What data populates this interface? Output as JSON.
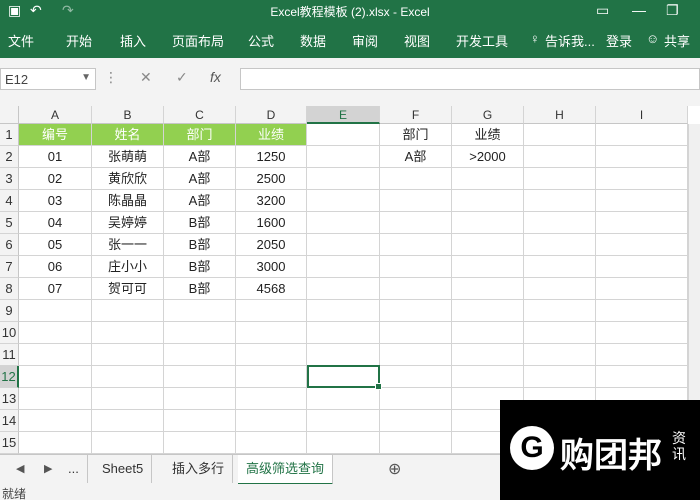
{
  "window": {
    "title": "Excel教程模板 (2).xlsx - Excel",
    "undo_icon": "undo-icon",
    "redo_icon": "redo-icon"
  },
  "ribbon": {
    "tabs": [
      "文件",
      "开始",
      "插入",
      "页面布局",
      "公式",
      "数据",
      "审阅",
      "视图",
      "开发工具"
    ],
    "tell_me": "告诉我...",
    "login": "登录",
    "share": "共享"
  },
  "formula_bar": {
    "name_box": "E12",
    "cancel_icon": "✕",
    "enter_icon": "✓",
    "fx": "fx",
    "value": ""
  },
  "sheet": {
    "columns": [
      "A",
      "B",
      "C",
      "D",
      "E",
      "F",
      "G",
      "H",
      "I"
    ],
    "rows": [
      "1",
      "2",
      "3",
      "4",
      "5",
      "6",
      "7",
      "8",
      "9",
      "10",
      "11",
      "12",
      "13",
      "14",
      "15"
    ],
    "table_headers": [
      "编号",
      "姓名",
      "部门",
      "业绩"
    ],
    "table_rows": [
      [
        "01",
        "张萌萌",
        "A部",
        "1250"
      ],
      [
        "02",
        "黄欣欣",
        "A部",
        "2500"
      ],
      [
        "03",
        "陈晶晶",
        "A部",
        "3200"
      ],
      [
        "04",
        "吴婷婷",
        "B部",
        "1600"
      ],
      [
        "05",
        "张一一",
        "B部",
        "2050"
      ],
      [
        "06",
        "庄小小",
        "B部",
        "3000"
      ],
      [
        "07",
        "贺可可",
        "B部",
        "4568"
      ]
    ],
    "criteria_headers": [
      "部门",
      "业绩"
    ],
    "criteria_values": [
      "A部",
      ">2000"
    ],
    "selected_cell": "E12"
  },
  "tabs": {
    "sheets": [
      "...",
      "Sheet5",
      "插入多行",
      "高级筛选查询"
    ],
    "active": "高级筛选查询"
  },
  "status": {
    "ready": "就绪"
  },
  "overlay": {
    "logo": "G",
    "brand": "购团邦",
    "side": "资讯"
  },
  "colors": {
    "excel_green": "#217346",
    "header_fill": "#92d050"
  }
}
